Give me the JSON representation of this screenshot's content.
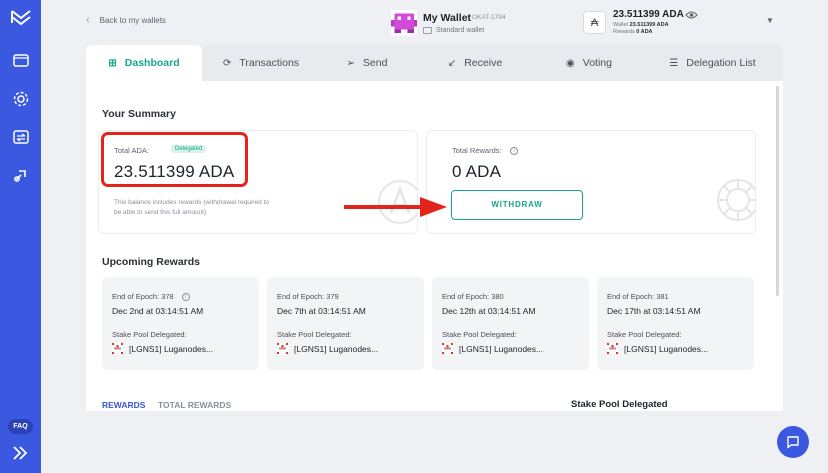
{
  "sidebar": {
    "faq_label": "FAQ",
    "items": [
      {
        "icon": "wallet-icon"
      },
      {
        "icon": "settings-icon"
      },
      {
        "icon": "exchange-icon"
      },
      {
        "icon": "staking-icon"
      }
    ]
  },
  "header": {
    "back_label": "Back to my wallets",
    "wallet_name": "My Wallet",
    "wallet_code": "OKAT-1794",
    "wallet_type": "Standard wallet",
    "balance": "23.511399 ADA",
    "wallet_sub_label": "Wallet",
    "wallet_sub_value": "23.511399 ADA",
    "rewards_sub_label": "Rewards",
    "rewards_sub_value": "0 ADA"
  },
  "tabs": [
    {
      "label": "Dashboard",
      "icon": "dashboard-icon",
      "active": true
    },
    {
      "label": "Transactions",
      "icon": "transactions-icon"
    },
    {
      "label": "Send",
      "icon": "send-icon"
    },
    {
      "label": "Receive",
      "icon": "receive-icon"
    },
    {
      "label": "Voting",
      "icon": "voting-icon"
    },
    {
      "label": "Delegation List",
      "icon": "list-icon"
    }
  ],
  "summary": {
    "title": "Your Summary",
    "total_ada_label": "Total ADA:",
    "delegated_badge": "Delegated",
    "total_ada_value": "23.511399 ADA",
    "note": "This balance includes rewards (withdrawal required to be able to send this full amount)",
    "total_rewards_label": "Total Rewards:",
    "total_rewards_value": "0 ADA",
    "withdraw_label": "WITHDRAW"
  },
  "upcoming": {
    "title": "Upcoming Rewards",
    "cards": [
      {
        "epoch": "End of Epoch:  378",
        "date": "Dec 2nd at 03:14:51 AM",
        "pool_label": "Stake Pool Delegated:",
        "pool": "[LGNS1] Luganodes..."
      },
      {
        "epoch": "End of Epoch:  379",
        "date": "Dec 7th at 03:14:51 AM",
        "pool_label": "Stake Pool Delegated:",
        "pool": "[LGNS1] Luganodes..."
      },
      {
        "epoch": "End of Epoch:  380",
        "date": "Dec 12th at 03:14:51 AM",
        "pool_label": "Stake Pool Delegated:",
        "pool": "[LGNS1] Luganodes..."
      },
      {
        "epoch": "End of Epoch:  381",
        "date": "Dec 17th at 03:14:51 AM",
        "pool_label": "Stake Pool Delegated:",
        "pool": "[LGNS1] Luganodes..."
      }
    ]
  },
  "bottom": {
    "rewards_tab": "REWARDS",
    "total_rewards_tab": "TOTAL REWARDS",
    "stake_pool_heading": "Stake Pool Delegated"
  },
  "colors": {
    "accent": "#17a689",
    "sidebar": "#3a58e0",
    "highlight": "#e3241b"
  }
}
